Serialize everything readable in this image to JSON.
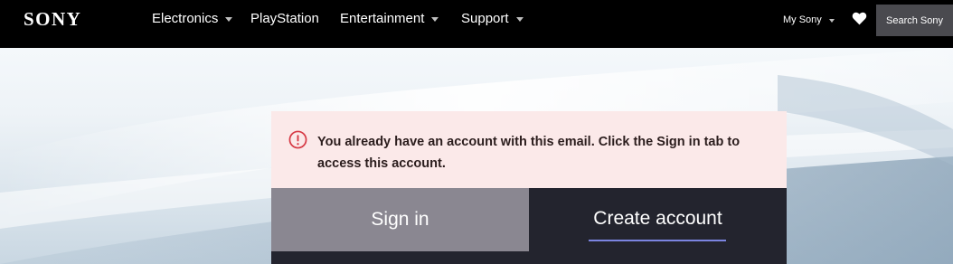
{
  "header": {
    "logo": "SONY",
    "nav": [
      {
        "label": "Electronics",
        "has_dropdown": true
      },
      {
        "label": "PlayStation",
        "has_dropdown": false
      },
      {
        "label": "Entertainment",
        "has_dropdown": true
      },
      {
        "label": "Support",
        "has_dropdown": true
      }
    ],
    "my_sony": "My Sony",
    "wishlist_icon": "heart-icon",
    "search_label": "Search Sony"
  },
  "alert": {
    "icon": "exclamation-circle-icon",
    "message": "You already have an account with this email. Click the Sign in tab to access this account.",
    "color": "#d63a45"
  },
  "tabs": {
    "sign_in": "Sign in",
    "create_account": "Create account",
    "active": "create_account",
    "accent_color": "#7b84e0"
  }
}
